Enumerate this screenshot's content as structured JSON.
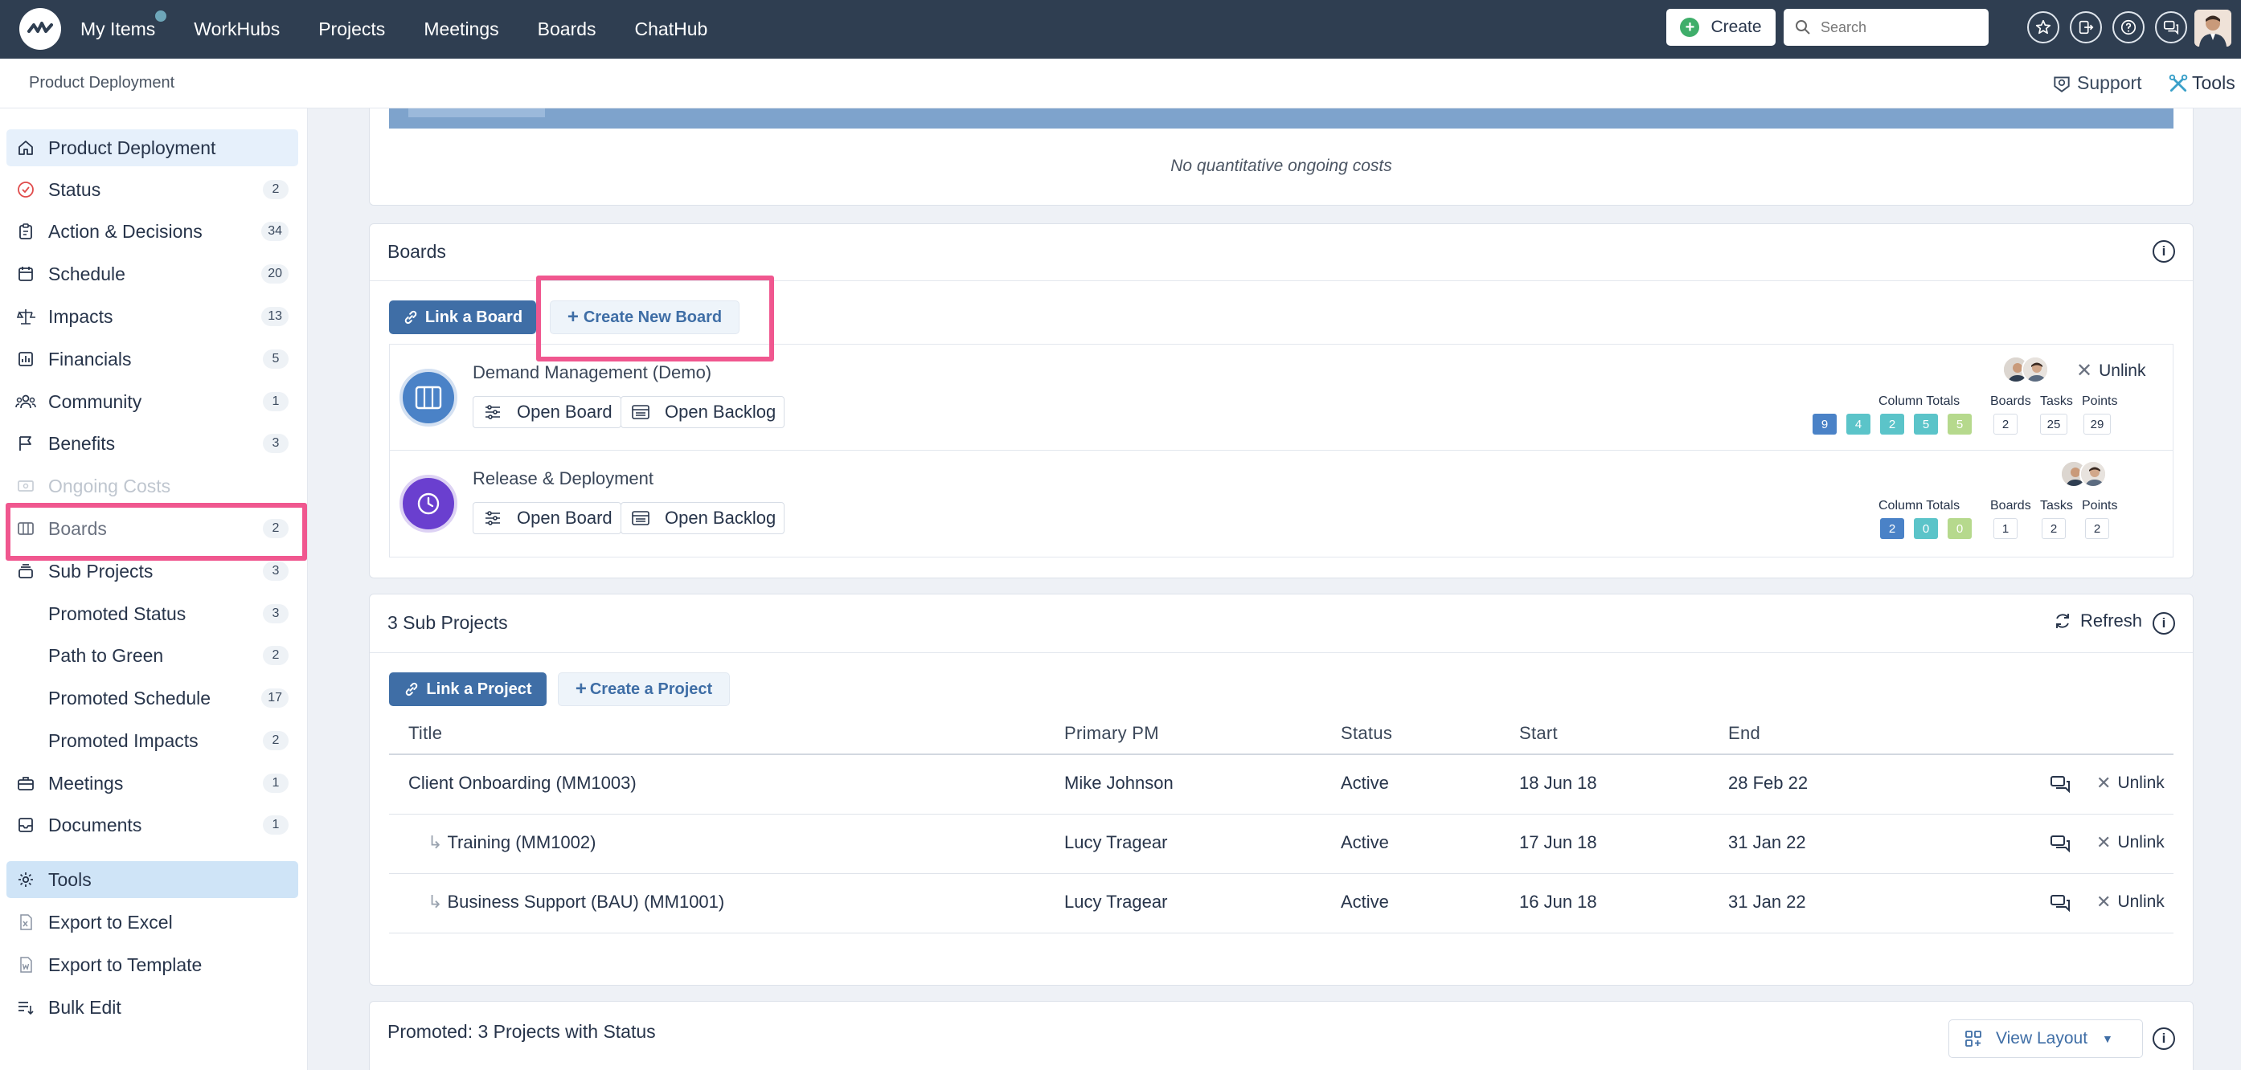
{
  "topnav": {
    "items": [
      {
        "label": "My Items",
        "has_dot": true
      },
      {
        "label": "WorkHubs"
      },
      {
        "label": "Projects"
      },
      {
        "label": "Meetings"
      },
      {
        "label": "Boards"
      },
      {
        "label": "ChatHub"
      }
    ],
    "create_label": "Create",
    "search_placeholder": "Search"
  },
  "subheader": {
    "breadcrumb": "Product Deployment",
    "support_label": "Support",
    "tools_label": "Tools"
  },
  "sidebar": {
    "items": [
      {
        "label": "Product Deployment",
        "count": "",
        "icon": "home-icon"
      },
      {
        "label": "Status",
        "count": "2",
        "icon": "status-check-icon"
      },
      {
        "label": "Action & Decisions",
        "count": "34",
        "icon": "clipboard-icon"
      },
      {
        "label": "Schedule",
        "count": "20",
        "icon": "calendar-icon"
      },
      {
        "label": "Impacts",
        "count": "13",
        "icon": "scale-icon"
      },
      {
        "label": "Financials",
        "count": "5",
        "icon": "bar-chart-icon"
      },
      {
        "label": "Community",
        "count": "1",
        "icon": "people-icon"
      },
      {
        "label": "Benefits",
        "count": "3",
        "icon": "flag-icon"
      },
      {
        "label": "Ongoing Costs",
        "count": "",
        "icon": "money-icon"
      },
      {
        "label": "Boards",
        "count": "2",
        "icon": "board-columns-icon"
      },
      {
        "label": "Sub Projects",
        "count": "3",
        "icon": "stack-icon"
      },
      {
        "label": "Promoted Status",
        "count": "3",
        "icon": ""
      },
      {
        "label": "Path to Green",
        "count": "2",
        "icon": ""
      },
      {
        "label": "Promoted Schedule",
        "count": "17",
        "icon": ""
      },
      {
        "label": "Promoted Impacts",
        "count": "2",
        "icon": ""
      },
      {
        "label": "Meetings",
        "count": "1",
        "icon": "briefcase-icon"
      },
      {
        "label": "Documents",
        "count": "1",
        "icon": "inbox-icon"
      },
      {
        "label": "Tools",
        "count": "",
        "icon": "gear-icon"
      },
      {
        "label": "Export to Excel",
        "count": "",
        "icon": "excel-file-icon"
      },
      {
        "label": "Export to Template",
        "count": "",
        "icon": "word-file-icon"
      },
      {
        "label": "Bulk Edit",
        "count": "",
        "icon": "bulk-edit-icon"
      }
    ]
  },
  "costs": {
    "empty_text": "No quantitative ongoing costs"
  },
  "boards": {
    "title": "Boards",
    "link_label": "Link a Board",
    "create_label": "Create New Board",
    "open_board_label": "Open Board",
    "open_backlog_label": "Open Backlog",
    "unlink_label": "Unlink",
    "column_totals_label": "Column Totals",
    "boards_label": "Boards",
    "tasks_label": "Tasks",
    "points_label": "Points",
    "items": [
      {
        "name": "Demand Management (Demo)",
        "circle_color": "#4a82c7",
        "column_totals": [
          "9",
          "4",
          "2",
          "5",
          "5"
        ],
        "chip_colors": [
          "#4a82c7",
          "#5bc4c9",
          "#5bc4c9",
          "#5bc4c9",
          "#b6d98d"
        ],
        "boards": "2",
        "tasks": "25",
        "points": "29"
      },
      {
        "name": "Release & Deployment",
        "circle_color": "#6a3fcf",
        "column_totals": [
          "2",
          "0",
          "0"
        ],
        "chip_colors": [
          "#4a82c7",
          "#5bc4c9",
          "#b6d98d"
        ],
        "boards": "1",
        "tasks": "2",
        "points": "2"
      }
    ]
  },
  "subprojects": {
    "title": "3 Sub Projects",
    "refresh_label": "Refresh",
    "link_label": "Link a Project",
    "create_label": "Create a Project",
    "unlink_label": "Unlink",
    "columns": [
      "Title",
      "Primary PM",
      "Status",
      "Start",
      "End"
    ],
    "rows": [
      {
        "title": "Client Onboarding (MM1003)",
        "pm": "Mike Johnson",
        "status": "Active",
        "start": "18 Jun 18",
        "end": "28 Feb 22",
        "child": false
      },
      {
        "title": "Training (MM1002)",
        "pm": "Lucy Tragear",
        "status": "Active",
        "start": "17 Jun 18",
        "end": "31 Jan 22",
        "child": true
      },
      {
        "title": "Business Support (BAU) (MM1001)",
        "pm": "Lucy Tragear",
        "status": "Active",
        "start": "16 Jun 18",
        "end": "31 Jan 22",
        "child": true
      }
    ]
  },
  "promoted": {
    "title": "Promoted: 3 Projects with Status",
    "view_layout_label": "View Layout"
  },
  "colors": {
    "nav_bg": "#2f3e51",
    "accent": "#3f6ea6",
    "highlight": "#f0578f"
  }
}
